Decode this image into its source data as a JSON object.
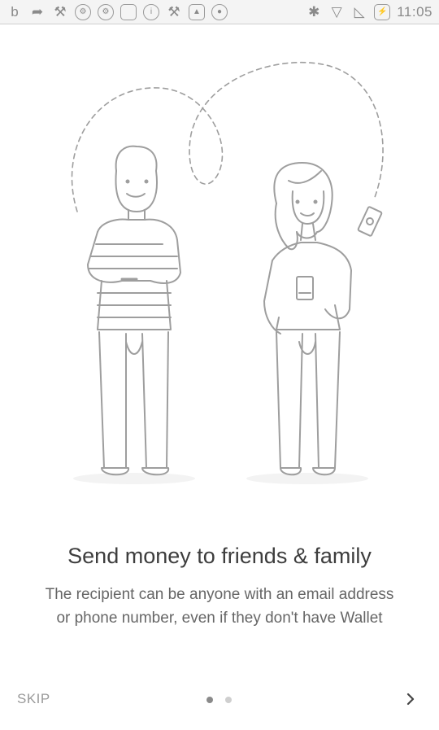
{
  "status_bar": {
    "time": "11:05",
    "left_icons": [
      "b-notification-icon",
      "share-icon",
      "wrench-icon",
      "settings-badge-icon",
      "settings-badge-icon",
      "square-icon",
      "info-icon",
      "tools-icon",
      "lock-icon",
      "android-icon"
    ],
    "right_icons": [
      "bluetooth-icon",
      "wifi-icon",
      "no-signal-icon",
      "battery-icon"
    ]
  },
  "onboarding": {
    "title": "Send money to friends & family",
    "subtitle_lines": [
      "The recipient can be anyone with an email address",
      "or phone number, even if they don't have Wallet"
    ]
  },
  "footer": {
    "skip_label": "SKIP",
    "page_indicator": {
      "current": 1,
      "total": 2
    },
    "next_icon": "chevron-right-icon"
  },
  "colors": {
    "background": "#ffffff",
    "text_primary": "#3d3d3d",
    "text_secondary": "#666666",
    "line_art": "#9e9e9e"
  }
}
